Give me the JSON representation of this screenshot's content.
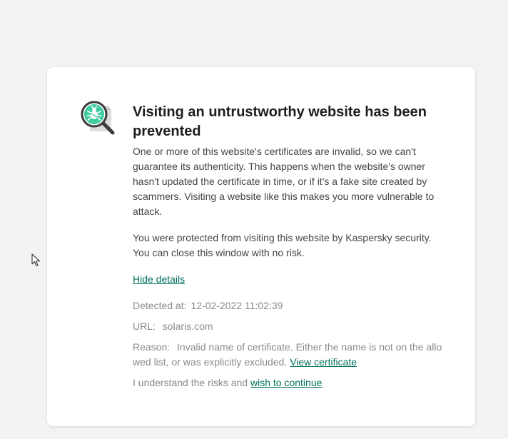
{
  "page": {
    "title": "Visiting an untrustworthy website has been prevented",
    "description": "One or more of this website's certificates are invalid, so we can't guarantee its authenticity. This happens when the website's owner hasn't updated the certificate in time, or if it's a fake site created by scammers. Visiting a website like this makes you more vulnerable to attack.",
    "protection_note": "You were protected from visiting this website by Kaspersky security. You can close this window with no risk.",
    "hide_details_label": "Hide details"
  },
  "details": {
    "detected_label": "Detected at:",
    "detected_value": "12-02-2022 11:02:39",
    "url_label": "URL:",
    "url_value": "solaris.com",
    "reason_label": "Reason:",
    "reason_value": "Invalid name of certificate. Either the name is not on the allowed list, or was explicitly excluded.",
    "view_certificate_label": "View certificate",
    "continue_prefix": "I understand the risks and",
    "continue_link": "wish to continue"
  },
  "icons": {
    "warning": "magnifier-bug-icon",
    "cursor": "mouse-cursor-icon"
  },
  "colors": {
    "accent": "#00715a",
    "icon_green": "#3ecca0",
    "background": "#f3f3f3"
  }
}
